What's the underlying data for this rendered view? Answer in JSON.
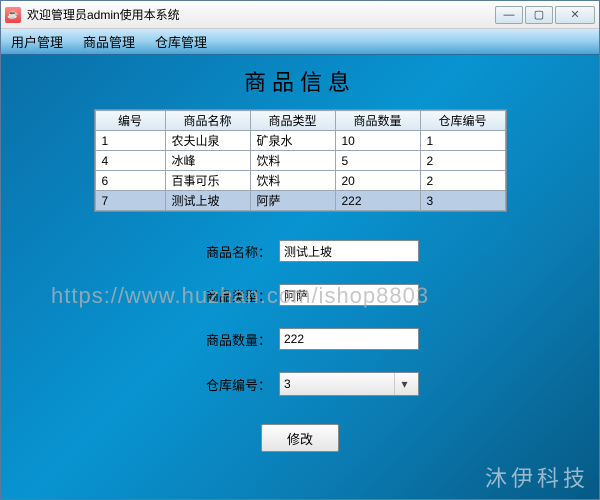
{
  "window": {
    "title": "欢迎管理员admin使用本系统"
  },
  "menubar": {
    "items": [
      "用户管理",
      "商品管理",
      "仓库管理"
    ]
  },
  "page": {
    "heading": "商品信息"
  },
  "table": {
    "headers": [
      "编号",
      "商品名称",
      "商品类型",
      "商品数量",
      "仓库编号"
    ],
    "rows": [
      {
        "id": "1",
        "name": "农夫山泉",
        "type": "矿泉水",
        "qty": "10",
        "wh": "1",
        "selected": false
      },
      {
        "id": "4",
        "name": "冰峰",
        "type": "饮料",
        "qty": "5",
        "wh": "2",
        "selected": false
      },
      {
        "id": "6",
        "name": "百事可乐",
        "type": "饮料",
        "qty": "20",
        "wh": "2",
        "selected": false
      },
      {
        "id": "7",
        "name": "测试上坡",
        "type": "阿萨",
        "qty": "222",
        "wh": "3",
        "selected": true
      }
    ]
  },
  "form": {
    "name_label": "商品名称：",
    "name_value": "测试上坡",
    "type_label": "商品类型：",
    "type_value": "阿萨",
    "qty_label": "商品数量：",
    "qty_value": "222",
    "wh_label": "仓库编号：",
    "wh_value": "3",
    "submit_label": "修改"
  },
  "watermarks": {
    "url": "https://www.huzhan.com/ishop8803",
    "brand": "沐伊科技"
  }
}
